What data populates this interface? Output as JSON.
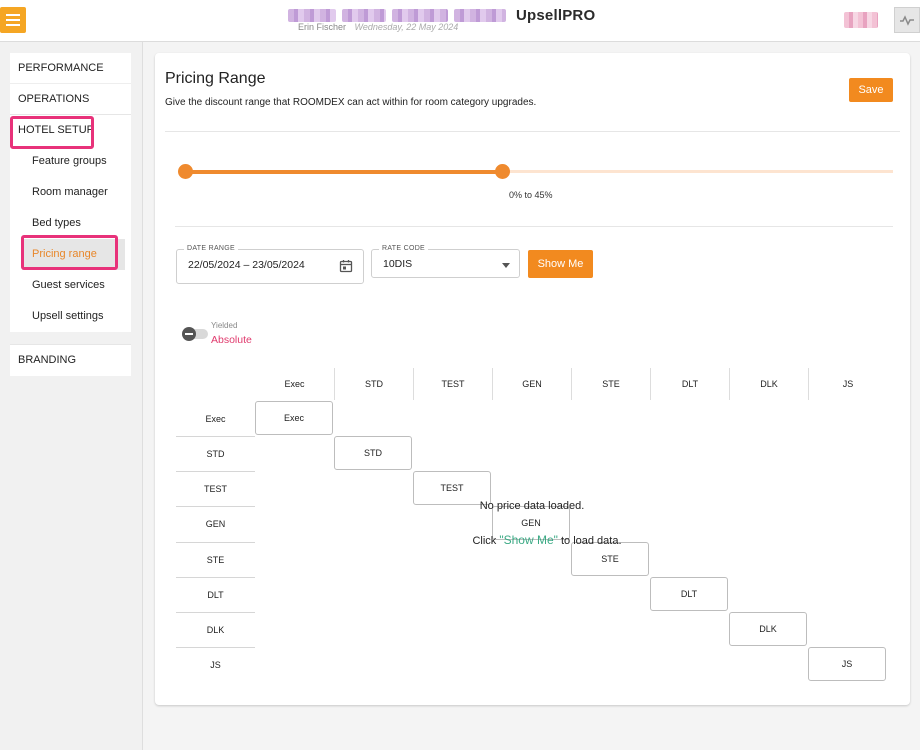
{
  "header": {
    "app_name": "UpsellPRO",
    "user_name": "Erin Fischer",
    "date": "Wednesday, 22 May 2024"
  },
  "sidebar": {
    "sections": [
      {
        "label": "PERFORMANCE"
      },
      {
        "label": "OPERATIONS"
      },
      {
        "label": "HOTEL SETUP"
      },
      {
        "label": "BRANDING"
      }
    ],
    "hotel_setup_items": [
      {
        "label": "Feature groups"
      },
      {
        "label": "Room manager"
      },
      {
        "label": "Bed types"
      },
      {
        "label": "Pricing range"
      },
      {
        "label": "Guest services"
      },
      {
        "label": "Upsell settings"
      }
    ],
    "active_item": "Pricing range"
  },
  "main": {
    "title": "Pricing Range",
    "description": "Give the discount range that ROOMDEX can act within for room category upgrades.",
    "save_label": "Save",
    "slider": {
      "min_percent": 0,
      "max_percent": 45,
      "label": "0% to 45%"
    },
    "date_range": {
      "legend": "DATE RANGE",
      "value": "22/05/2024 – 23/05/2024"
    },
    "rate_code": {
      "legend": "RATE CODE",
      "value": "10DIS"
    },
    "show_me_label": "Show Me",
    "toggle": {
      "yielded_label": "Yielded",
      "absolute_label": "Absolute",
      "state": "absolute"
    },
    "matrix": {
      "columns": [
        "Exec",
        "STD",
        "TEST",
        "GEN",
        "STE",
        "DLT",
        "DLK",
        "JS"
      ],
      "rows": [
        "Exec",
        "STD",
        "TEST",
        "GEN",
        "STE",
        "DLT",
        "DLK",
        "JS"
      ],
      "diagonal_cells": [
        "Exec",
        "STD",
        "TEST",
        "GEN",
        "STE",
        "DLT",
        "DLK",
        "JS"
      ]
    },
    "empty_state": {
      "line1": "No price data loaded.",
      "click_text": "Click ",
      "link_text": "\"Show Me\"",
      "suffix_text": " to load data."
    }
  },
  "colors": {
    "accent": "#f28a1f",
    "highlight": "#e8327a",
    "absolute_label": "#e03a6d",
    "link": "#3aa984"
  }
}
